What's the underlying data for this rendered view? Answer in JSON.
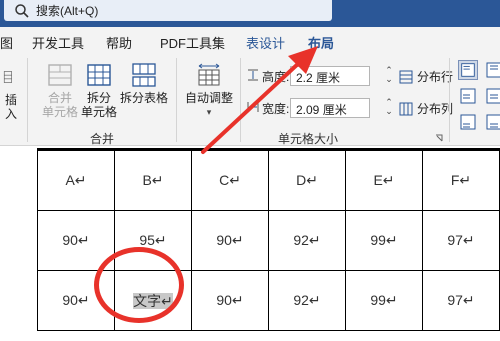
{
  "search": {
    "label": "搜索(Alt+Q)"
  },
  "tabs": [
    "图",
    "开发工具",
    "帮助",
    "PDF工具集",
    "表设计",
    "布局"
  ],
  "ribbon": {
    "insert_label": "插入",
    "merge_cells": "合并\n单元格",
    "split_cells": "拆分\n单元格",
    "split_table": "拆分表格",
    "merge_group": "合并",
    "autofit": "自动调整",
    "height_label": "高度:",
    "height_value": "2.2 厘米",
    "width_label": "宽度:",
    "width_value": "2.09 厘米",
    "distribute_rows": "分布行",
    "distribute_cols": "分布列",
    "cell_size_group": "单元格大小"
  },
  "table": {
    "rows": [
      [
        "A↵",
        "B↵",
        "C↵",
        "D↵",
        "E↵",
        "F↵"
      ],
      [
        "90↵",
        "95↵",
        "90↵",
        "92↵",
        "99↵",
        "97↵"
      ],
      [
        "90↵",
        "文字↵",
        "90↵",
        "92↵",
        "99↵",
        "97↵"
      ]
    ]
  },
  "colors": {
    "accent": "#2b5797",
    "annotation": "#e8322a"
  }
}
